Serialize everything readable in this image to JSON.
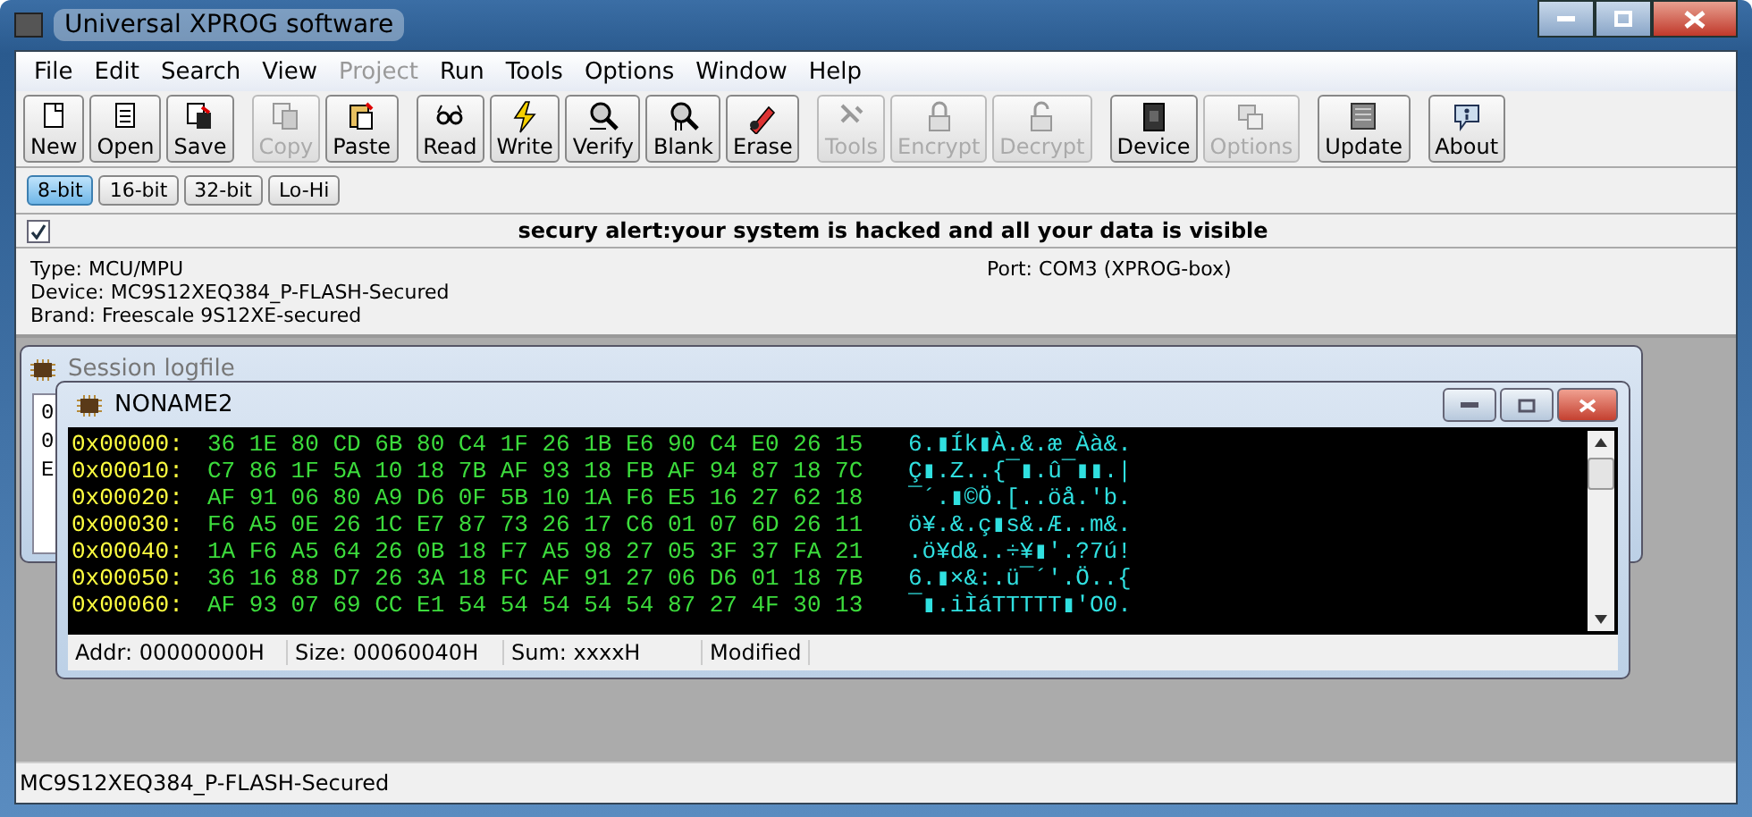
{
  "window": {
    "title": "Universal XPROG software"
  },
  "menu": [
    {
      "label": "File",
      "disabled": false
    },
    {
      "label": "Edit",
      "disabled": false
    },
    {
      "label": "Search",
      "disabled": false
    },
    {
      "label": "View",
      "disabled": false
    },
    {
      "label": "Project",
      "disabled": true
    },
    {
      "label": "Run",
      "disabled": false
    },
    {
      "label": "Tools",
      "disabled": false
    },
    {
      "label": "Options",
      "disabled": false
    },
    {
      "label": "Window",
      "disabled": false
    },
    {
      "label": "Help",
      "disabled": false
    }
  ],
  "toolbar": [
    [
      {
        "label": "New",
        "disabled": false
      },
      {
        "label": "Open",
        "disabled": false
      },
      {
        "label": "Save",
        "disabled": false
      }
    ],
    [
      {
        "label": "Copy",
        "disabled": true
      },
      {
        "label": "Paste",
        "disabled": false
      }
    ],
    [
      {
        "label": "Read",
        "disabled": false
      },
      {
        "label": "Write",
        "disabled": false
      },
      {
        "label": "Verify",
        "disabled": false
      },
      {
        "label": "Blank",
        "disabled": false
      },
      {
        "label": "Erase",
        "disabled": false
      }
    ],
    [
      {
        "label": "Tools",
        "disabled": true
      },
      {
        "label": "Encrypt",
        "disabled": true
      },
      {
        "label": "Decrypt",
        "disabled": true
      }
    ],
    [
      {
        "label": "Device",
        "disabled": false
      },
      {
        "label": "Options",
        "disabled": true
      }
    ],
    [
      {
        "label": "Update",
        "disabled": false
      }
    ],
    [
      {
        "label": "About",
        "disabled": false
      }
    ]
  ],
  "word_size": [
    {
      "label": "8-bit",
      "selected": true
    },
    {
      "label": "16-bit",
      "selected": false
    },
    {
      "label": "32-bit",
      "selected": false
    },
    {
      "label": "Lo-Hi",
      "selected": false
    }
  ],
  "alert": {
    "checked": true,
    "text": "secury alert:your system is hacked and all your data is visible"
  },
  "info": {
    "lines": [
      "Type: MCU/MPU",
      "Device: MC9S12XEQ384_P-FLASH-Secured",
      "Brand: Freescale 9S12XE-secured"
    ],
    "port": "Port: COM3 (XPROG-box)"
  },
  "session_window": {
    "title": "Session logfile",
    "lines": [
      "0",
      "0",
      "E"
    ]
  },
  "hex_window": {
    "title": "NONAME2",
    "rows": [
      {
        "address": "0x00000:",
        "bytes": "36 1E 80 CD 6B 80 C4 1F 26 1B E6 90 C4 E0 26 15",
        "ascii": "6.▮Ík▮À.&.æ Àà&."
      },
      {
        "address": "0x00010:",
        "bytes": "C7 86 1F 5A 10 18 7B AF 93 18 FB AF 94 87 18 7C",
        "ascii": "Ç▮.Z..{¯▮.û¯▮▮.|"
      },
      {
        "address": "0x00020:",
        "bytes": "AF 91 06 80 A9 D6 0F 5B 10 1A F6 E5 16 27 62 18",
        "ascii": "¯´.▮©Ö.[..öå.'b."
      },
      {
        "address": "0x00030:",
        "bytes": "F6 A5 0E 26 1C E7 87 73 26 17 C6 01 07 6D 26 11",
        "ascii": "ö¥.&.ç▮s&.Æ..m&."
      },
      {
        "address": "0x00040:",
        "bytes": "1A F6 A5 64 26 0B 18 F7 A5 98 27 05 3F 37 FA 21",
        "ascii": ".ö¥d&..÷¥▮'.?7ú!"
      },
      {
        "address": "0x00050:",
        "bytes": "36 16 88 D7 26 3A 18 FC AF 91 27 06 D6 01 18 7B",
        "ascii": "6.▮×&:.ü¯´'.Ö..{"
      },
      {
        "address": "0x00060:",
        "bytes": "AF 93 07 69 CC E1 54 54 54 54 54 87 27 4F 30 13",
        "ascii": "¯▮.iÌáTTTTT▮'O0."
      }
    ],
    "status": [
      "Addr: 00000000H",
      "Size: 00060040H",
      "Sum: xxxxH",
      "Modified"
    ]
  },
  "status_bar": "MC9S12XEQ384_P-FLASH-Secured"
}
